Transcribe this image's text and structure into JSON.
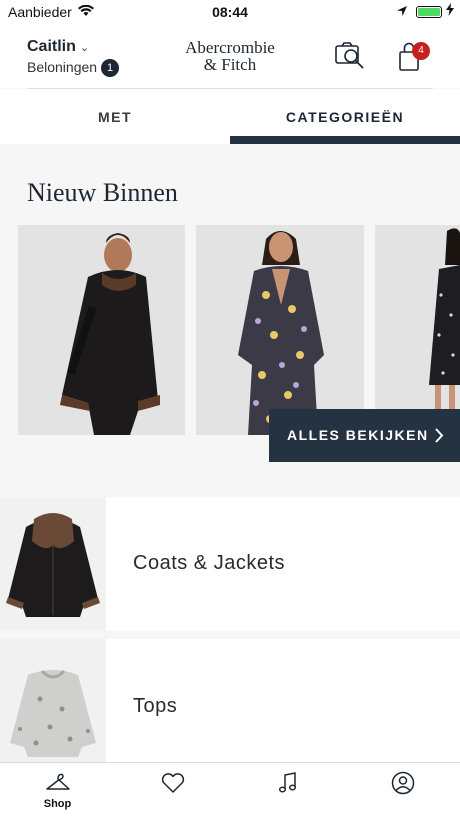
{
  "status_bar": {
    "carrier": "Aanbieder",
    "time": "08:44",
    "icons": [
      "wifi-icon",
      "location-arrow-icon",
      "battery-icon",
      "charging-bolt-icon"
    ],
    "battery_color": "#4cd964"
  },
  "header": {
    "user_name": "Caitlin",
    "rewards_label": "Beloningen",
    "rewards_count": "1",
    "logo_line1": "Abercrombie",
    "logo_line2": "& Fitch",
    "bag_count": "4",
    "icons": [
      "camera-search-icon",
      "shopping-bag-icon"
    ]
  },
  "tabs": [
    {
      "label": "MET",
      "active": false
    },
    {
      "label": "CATEGORIEËN",
      "active": true
    }
  ],
  "new_arrivals": {
    "title": "Nieuw Binnen",
    "view_all_label": "ALLES BEKIJKEN",
    "products": [
      {
        "description": "shearling jacket photo"
      },
      {
        "description": "floral wrap dress photo"
      },
      {
        "description": "patterned dress photo"
      }
    ]
  },
  "categories": [
    {
      "label": "Coats & Jackets"
    },
    {
      "label": "Tops"
    }
  ],
  "tab_bar": {
    "shop_label": "Shop",
    "icons": [
      "hanger-icon",
      "heart-icon",
      "music-note-icon",
      "account-icon"
    ]
  },
  "colors": {
    "navy": "#253241",
    "badge_red": "#c81f1f",
    "background": "#f6f6f6"
  }
}
